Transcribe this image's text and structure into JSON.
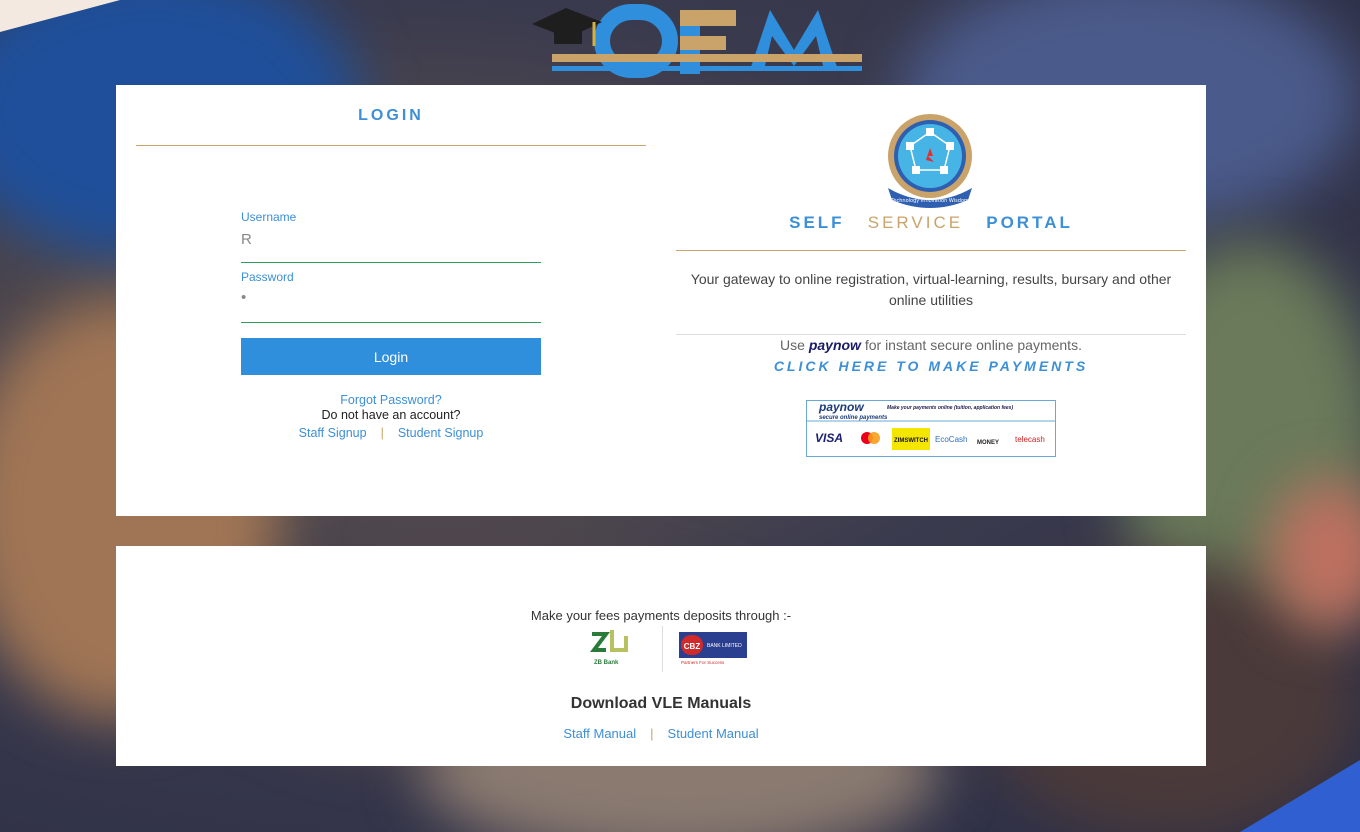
{
  "login": {
    "title": "LOGIN",
    "username_label": "Username",
    "username_value": "R",
    "password_label": "Password",
    "password_value": "•",
    "button_label": "Login",
    "forgot_password": "Forgot Password?",
    "no_account": "Do not have an account?",
    "staff_signup": "Staff Signup",
    "separator": "|",
    "student_signup": "Student Signup"
  },
  "portal": {
    "title_word1": "SELF",
    "title_word2": "SERVICE",
    "title_word3": "PORTAL",
    "seal_text": "Technology Innovation Wisdom",
    "description": "Your gateway to online registration, virtual-learning, results, bursary and other online utilities",
    "use_prefix": "Use",
    "use_brand": "paynow",
    "use_suffix": "for instant secure online payments.",
    "click_here": "CLICK HERE TO MAKE PAYMENTS"
  },
  "paynow_banner": {
    "brand": "paynow",
    "tagline": "Make your payments online (tuition, application fees)",
    "subtitle": "secure online payments",
    "methods": [
      "VISA",
      "ZIMSWITCH",
      "EcoCash",
      "MONEY",
      "telecash"
    ]
  },
  "footer": {
    "deposit_text": "Make your fees payments deposits through :-",
    "zb_bank_label": "ZB Bank",
    "cbz_label": "CBZ",
    "cbz_sub": "BANK LIMITED",
    "cbz_tagline": "Partners For Success",
    "vle_title": "Download VLE Manuals",
    "staff_manual": "Staff Manual",
    "separator": "|",
    "student_manual": "Student Manual"
  },
  "colors": {
    "accent_blue": "#3d8fd6",
    "button_blue": "#2f8fdc",
    "gold": "#c9a36a",
    "input_underline": "#2e9e5b"
  }
}
